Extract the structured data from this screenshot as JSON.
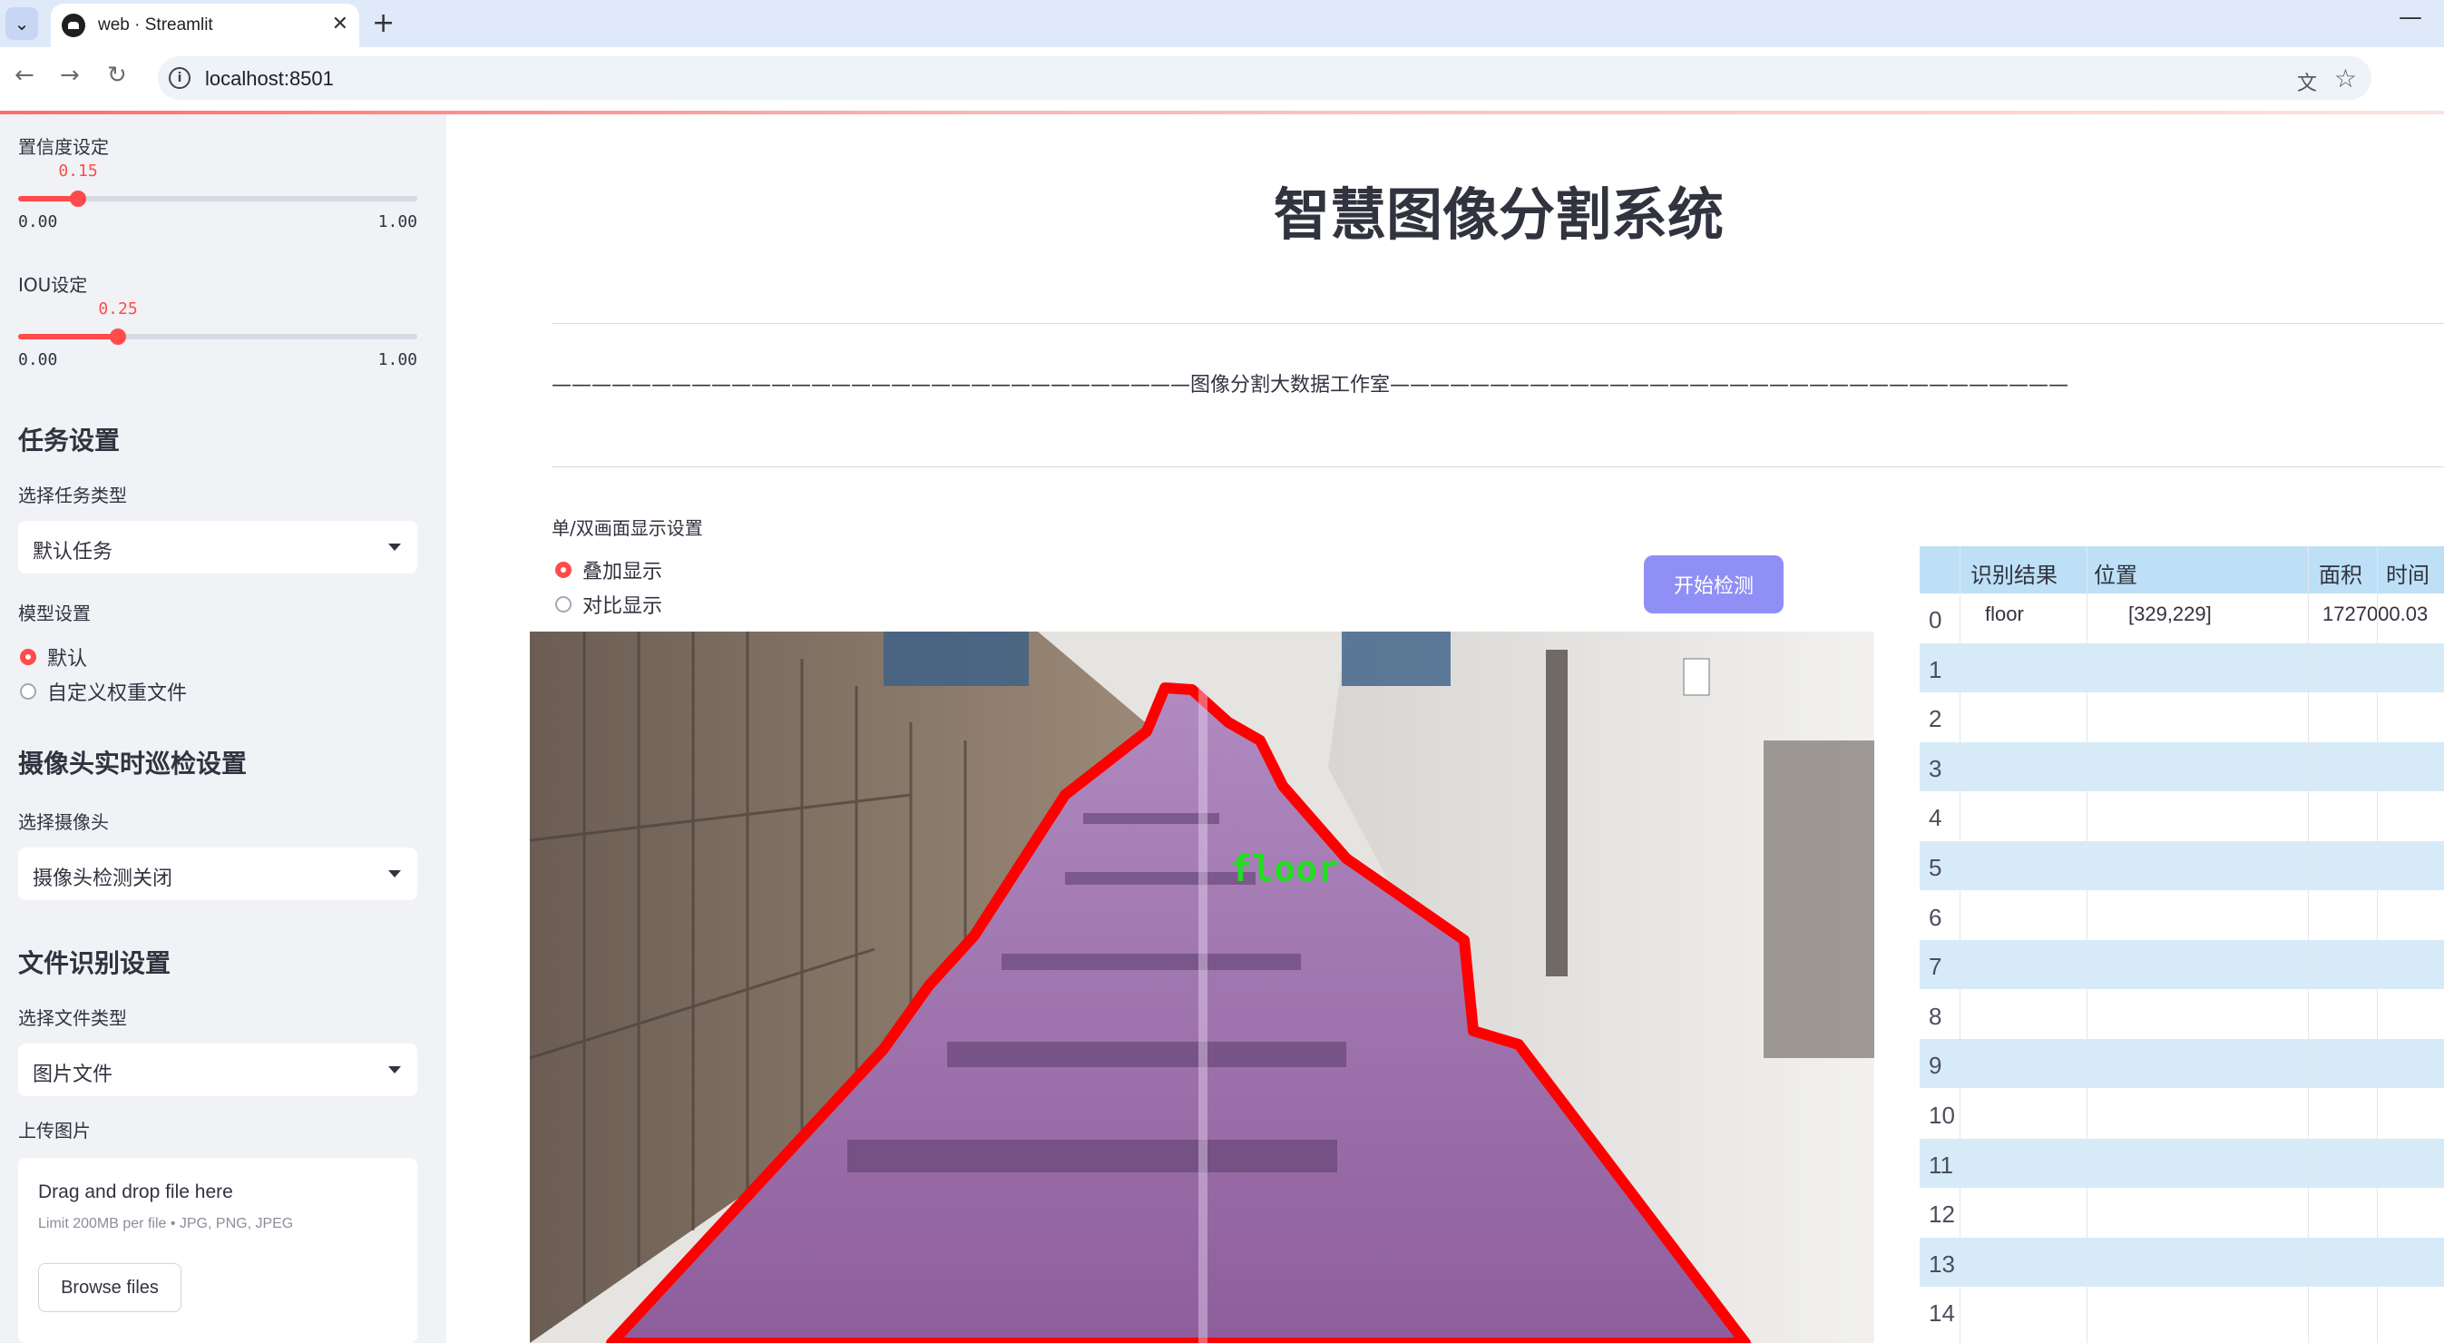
{
  "browser": {
    "tab_title": "web · Streamlit",
    "url": "localhost:8501"
  },
  "sidebar": {
    "confidence": {
      "label": "置信度设定",
      "value": 0.15,
      "value_text": "0.15",
      "min": "0.00",
      "max": "1.00"
    },
    "iou": {
      "label": "IOU设定",
      "value": 0.25,
      "value_text": "0.25",
      "min": "0.00",
      "max": "1.00"
    },
    "task_header": "任务设置",
    "task_type_label": "选择任务类型",
    "task_type_value": "默认任务",
    "model_label": "模型设置",
    "model_options": [
      "默认",
      "自定义权重文件"
    ],
    "model_selected": "默认",
    "camera_header": "摄像头实时巡检设置",
    "camera_label": "选择摄像头",
    "camera_value": "摄像头检测关闭",
    "file_header": "文件识别设置",
    "file_type_label": "选择文件类型",
    "file_type_value": "图片文件",
    "upload_label": "上传图片",
    "upload_title": "Drag and drop file here",
    "upload_limit": "Limit 200MB per file • JPG, PNG, JPEG",
    "upload_button": "Browse files"
  },
  "main": {
    "title": "智慧图像分割系统",
    "divider_text": "————————————————————————————————图像分割大数据工作室——————————————————————————————————",
    "display_mode_label": "单/双画面显示设置",
    "display_options": [
      "叠加显示",
      "对比显示"
    ],
    "display_selected": "叠加显示",
    "start_button": "开始检测",
    "detection_label": "floor",
    "colors": {
      "accent": "#ff4b4b",
      "mask": "#9b5aa8",
      "outline": "#ff0000",
      "label": "#22dd22",
      "button": "#8f8ff5"
    }
  },
  "table": {
    "columns": [
      "",
      "识别结果",
      "位置",
      "面积",
      "时间"
    ],
    "rows": [
      {
        "index": "0",
        "result": "floor",
        "position": "[329,229]",
        "area": "1727000.03"
      },
      {
        "index": "1"
      },
      {
        "index": "2"
      },
      {
        "index": "3"
      },
      {
        "index": "4"
      },
      {
        "index": "5"
      },
      {
        "index": "6"
      },
      {
        "index": "7"
      },
      {
        "index": "8"
      },
      {
        "index": "9"
      },
      {
        "index": "10"
      },
      {
        "index": "11"
      },
      {
        "index": "12"
      },
      {
        "index": "13"
      },
      {
        "index": "14"
      }
    ]
  }
}
